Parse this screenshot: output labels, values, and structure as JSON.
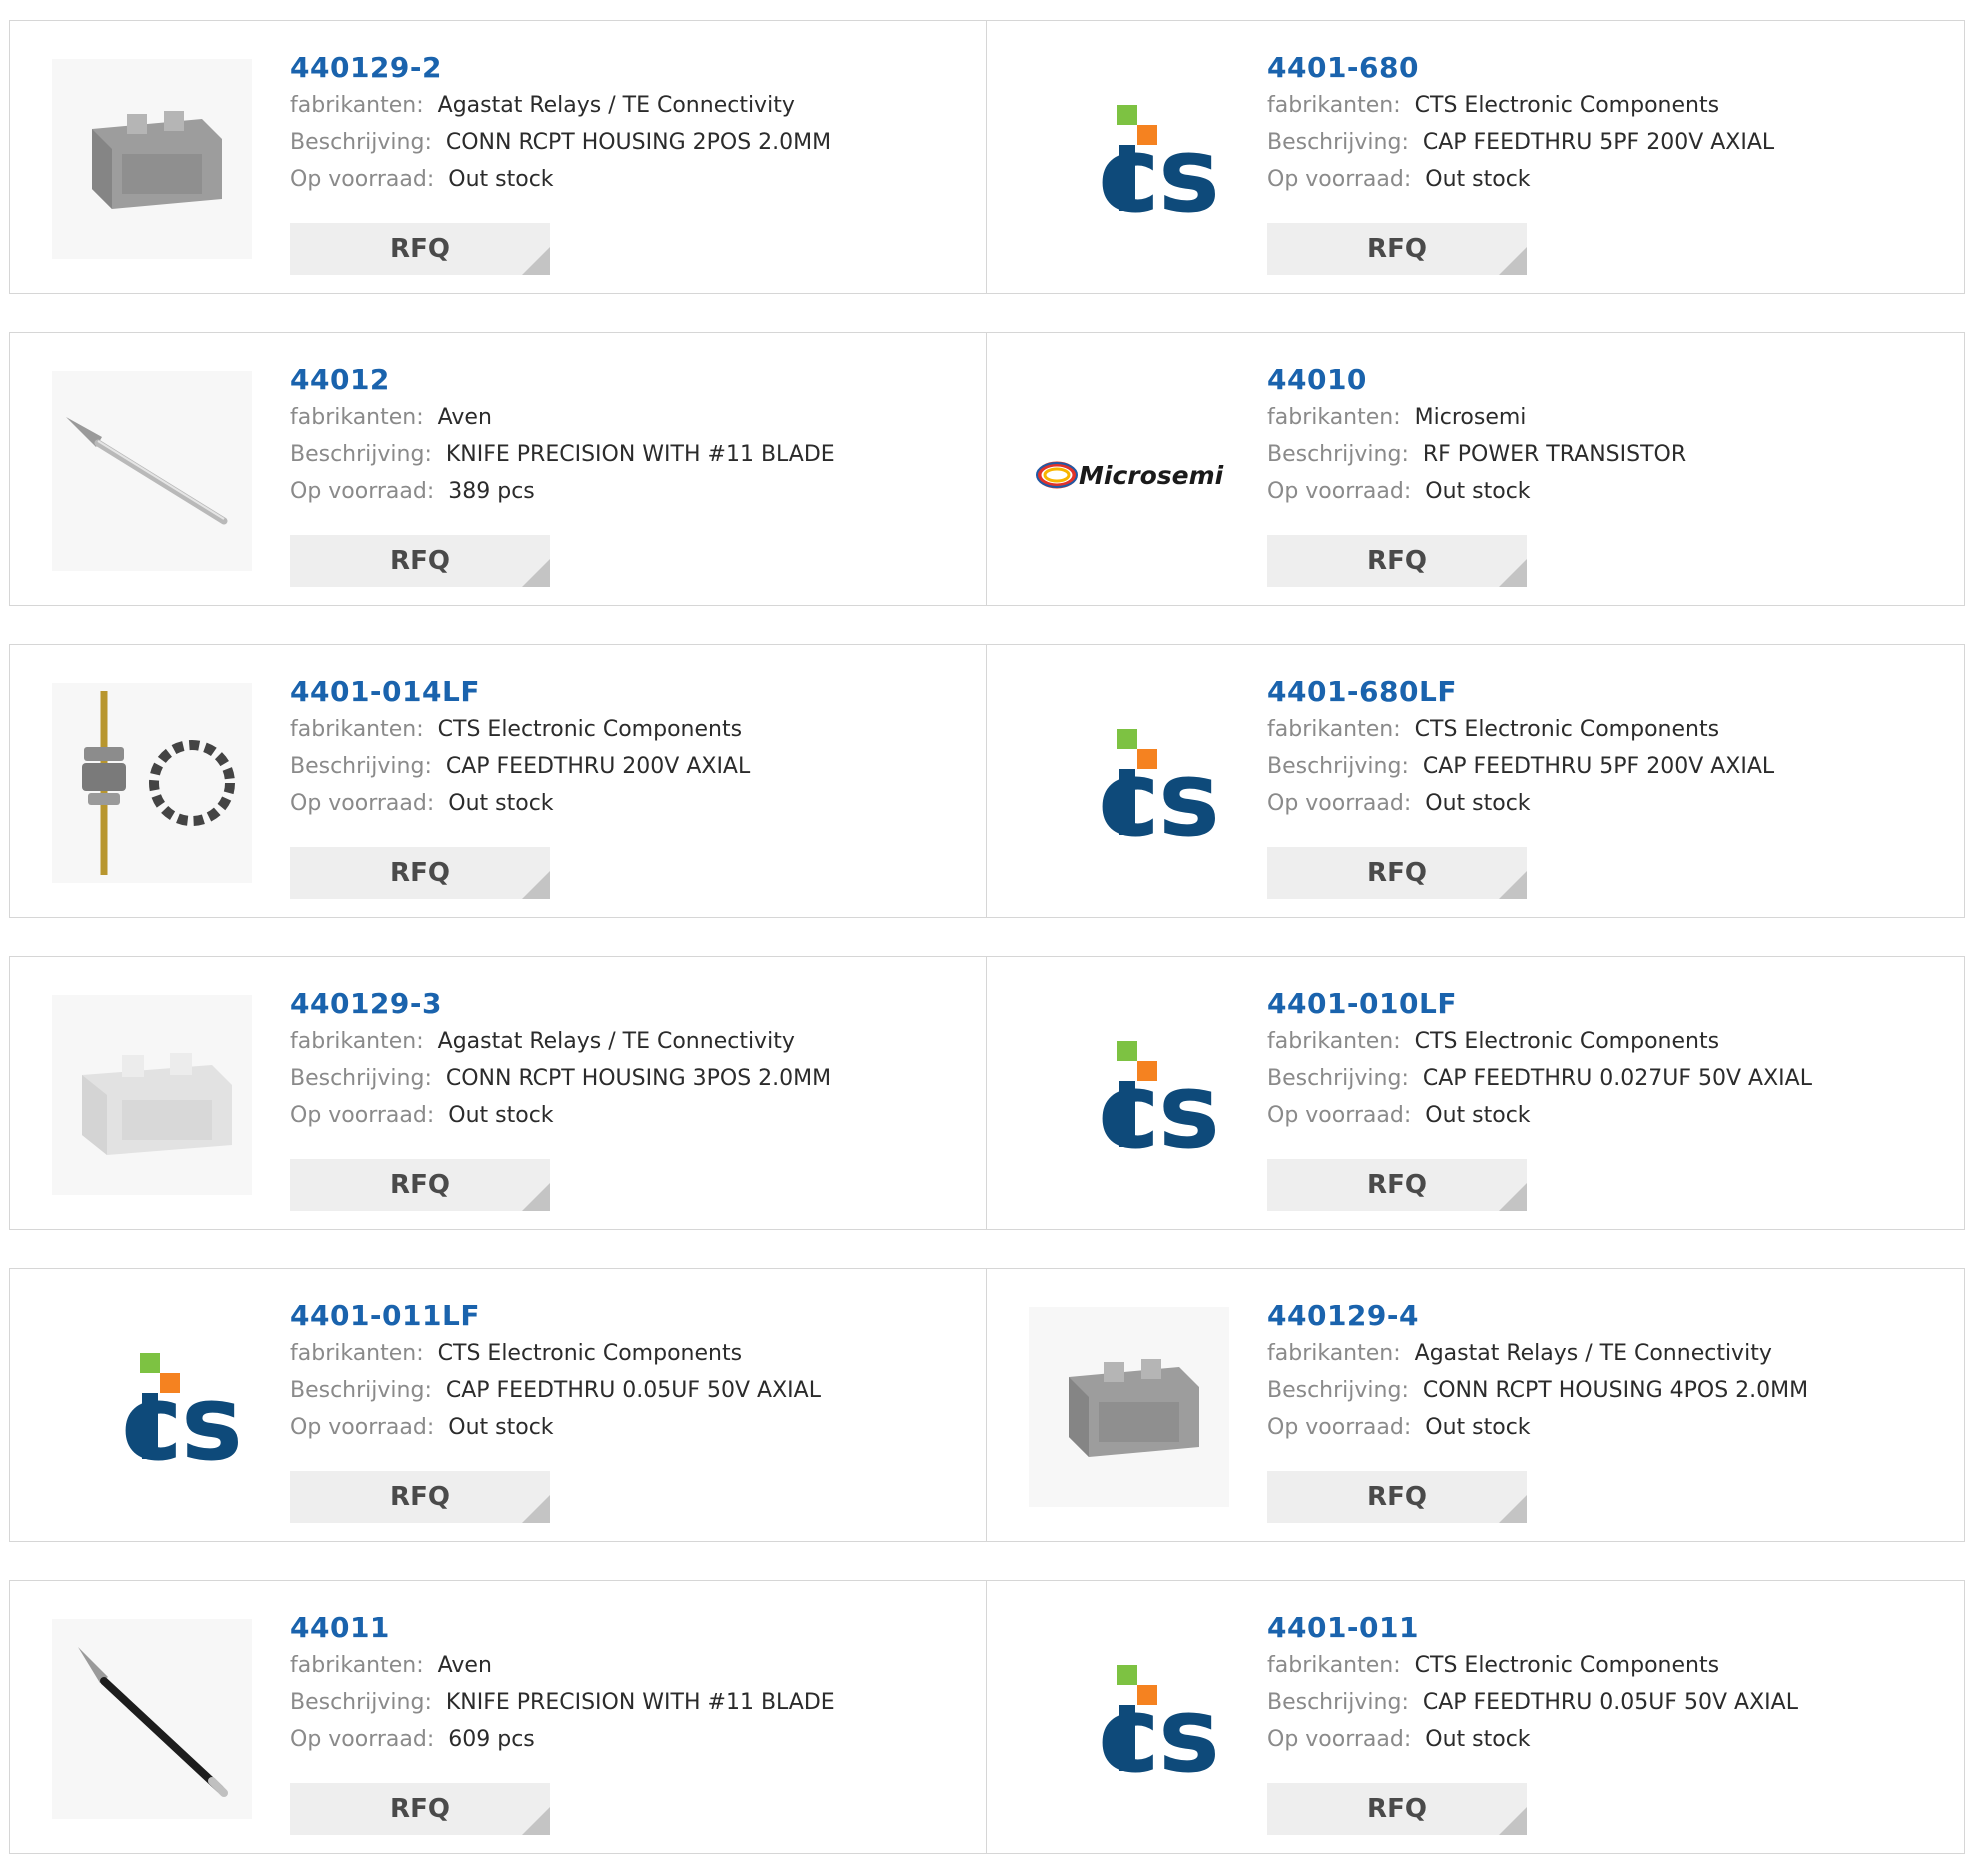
{
  "labels": {
    "manufacturer": "fabrikanten:",
    "description": "Beschrijving:",
    "stock": "Op voorraad:",
    "rfq": "RFQ"
  },
  "colors": {
    "part_number": "#1a63ad",
    "cts_blue": "#0e4a7a",
    "cts_green": "#7dc242",
    "cts_orange": "#f58220"
  },
  "products": [
    {
      "part": "440129-2",
      "manufacturer": "Agastat Relays / TE Connectivity",
      "description": "CONN RCPT HOUSING 2POS 2.0MM",
      "stock": "Out stock",
      "image": "connector-housing-gray"
    },
    {
      "part": "4401-680",
      "manufacturer": "CTS Electronic Components",
      "description": "CAP FEEDTHRU 5PF 200V AXIAL",
      "stock": "Out stock",
      "image": "cts-logo"
    },
    {
      "part": "44012",
      "manufacturer": "Aven",
      "description": "KNIFE PRECISION WITH #11 BLADE",
      "stock": "389 pcs",
      "image": "precision-knife-silver"
    },
    {
      "part": "44010",
      "manufacturer": "Microsemi",
      "description": "RF POWER TRANSISTOR",
      "stock": "Out stock",
      "image": "microsemi-logo"
    },
    {
      "part": "4401-014LF",
      "manufacturer": "CTS Electronic Components",
      "description": "CAP FEEDTHRU 200V AXIAL",
      "stock": "Out stock",
      "image": "feedthru-capacitor"
    },
    {
      "part": "4401-680LF",
      "manufacturer": "CTS Electronic Components",
      "description": "CAP FEEDTHRU 5PF 200V AXIAL",
      "stock": "Out stock",
      "image": "cts-logo"
    },
    {
      "part": "440129-3",
      "manufacturer": "Agastat Relays / TE Connectivity",
      "description": "CONN RCPT HOUSING 3POS 2.0MM",
      "stock": "Out stock",
      "image": "connector-housing-white"
    },
    {
      "part": "4401-010LF",
      "manufacturer": "CTS Electronic Components",
      "description": "CAP FEEDTHRU 0.027UF 50V AXIAL",
      "stock": "Out stock",
      "image": "cts-logo"
    },
    {
      "part": "4401-011LF",
      "manufacturer": "CTS Electronic Components",
      "description": "CAP FEEDTHRU 0.05UF 50V AXIAL",
      "stock": "Out stock",
      "image": "cts-logo"
    },
    {
      "part": "440129-4",
      "manufacturer": "Agastat Relays / TE Connectivity",
      "description": "CONN RCPT HOUSING 4POS 2.0MM",
      "stock": "Out stock",
      "image": "connector-housing-gray"
    },
    {
      "part": "44011",
      "manufacturer": "Aven",
      "description": "KNIFE PRECISION WITH #11 BLADE",
      "stock": "609 pcs",
      "image": "precision-knife-black"
    },
    {
      "part": "4401-011",
      "manufacturer": "CTS Electronic Components",
      "description": "CAP FEEDTHRU 0.05UF 50V AXIAL",
      "stock": "Out stock",
      "image": "cts-logo"
    }
  ]
}
